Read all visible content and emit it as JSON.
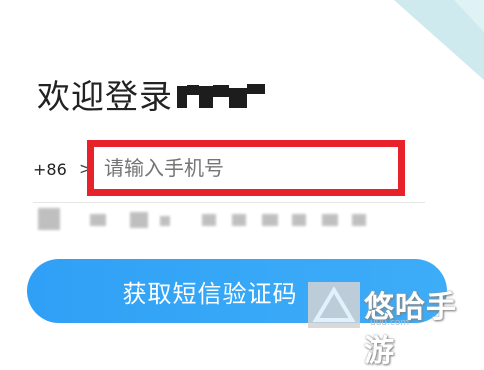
{
  "login": {
    "title": "欢迎登录"
  },
  "phone": {
    "country_code": "+86",
    "arrow": ">",
    "placeholder": "请输入手机号"
  },
  "actions": {
    "get_code_label": "获取短信验证码"
  },
  "watermark": {
    "text": "悠哈手游",
    "url": "uuu.com"
  },
  "colors": {
    "accent_blue": "#30a0f6",
    "highlight_red": "#e8222a",
    "placeholder_gray": "#b3b3b3"
  }
}
